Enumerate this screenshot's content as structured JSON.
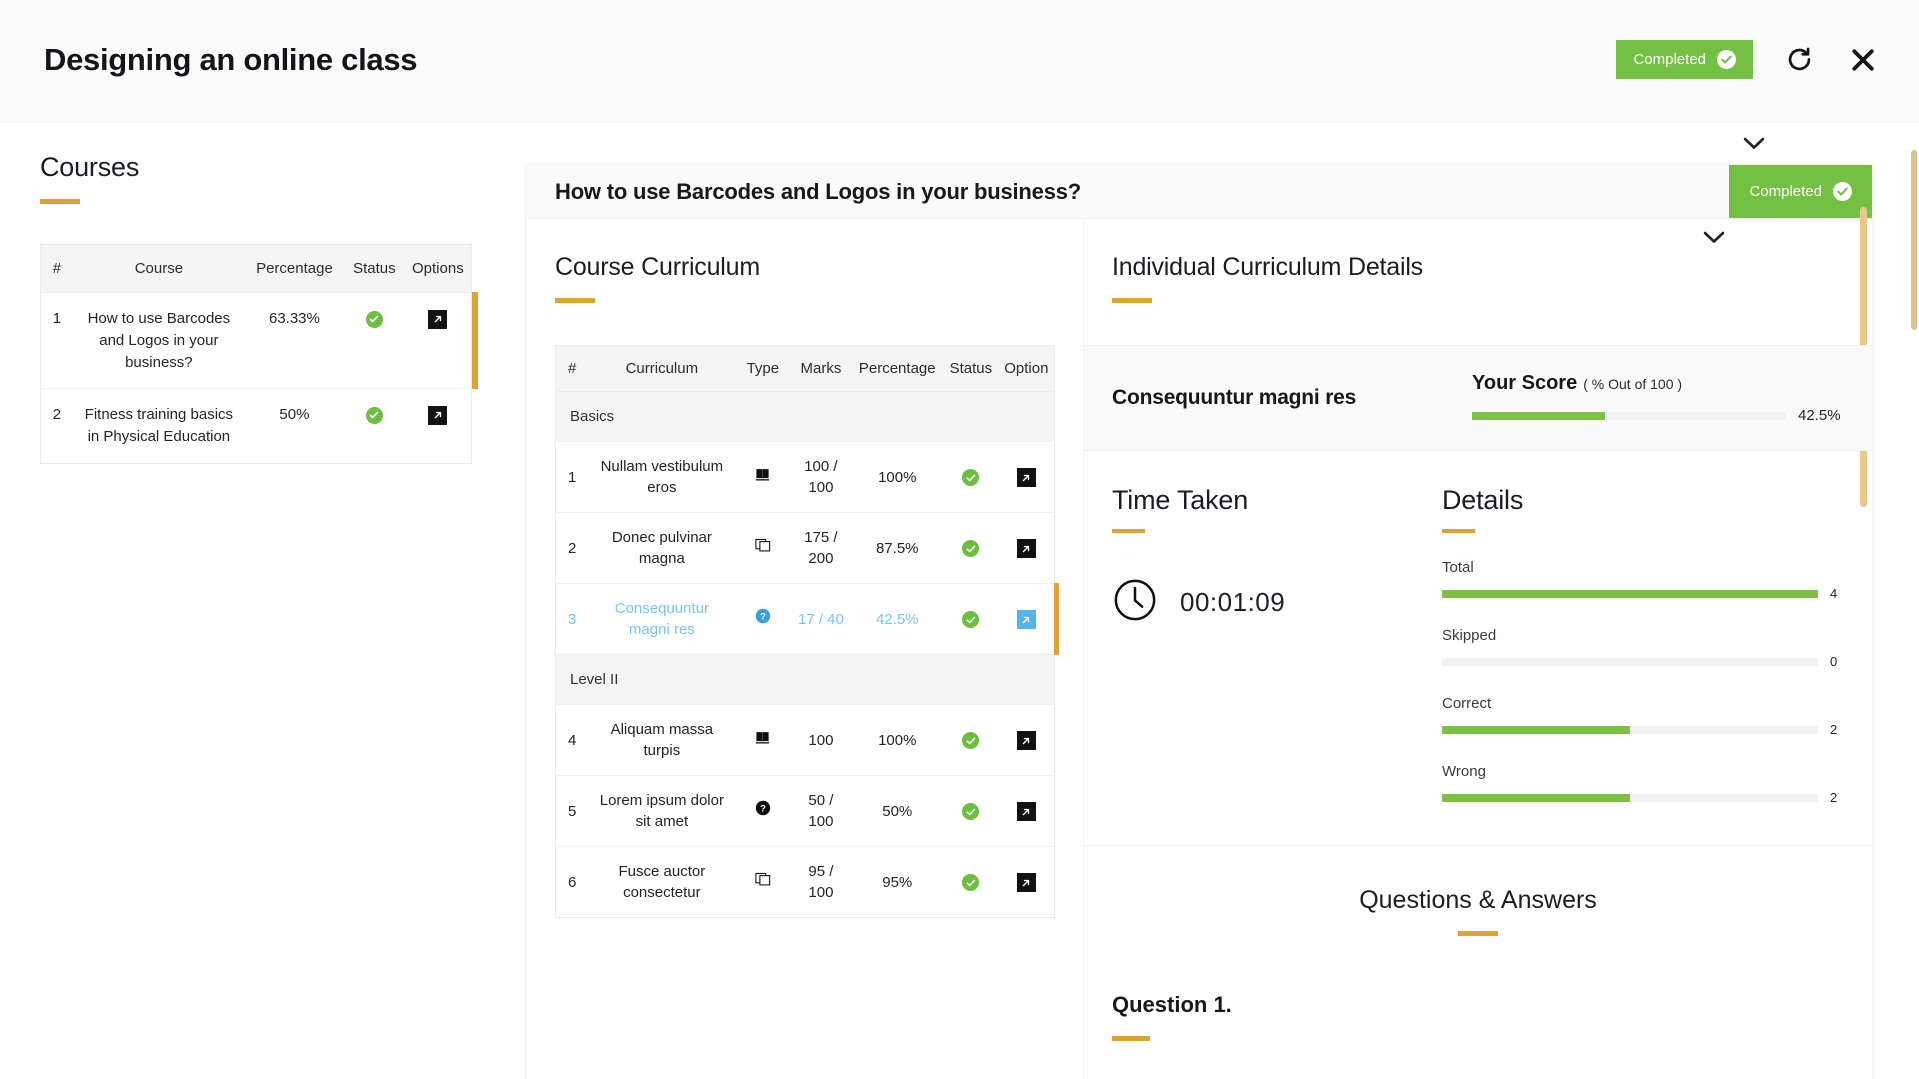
{
  "topbar": {
    "title": "Designing an online class",
    "status_badge": "Completed",
    "refresh_icon": "refresh-icon",
    "close_icon": "close-icon"
  },
  "sidebar": {
    "title": "Courses",
    "table": {
      "headers": [
        "#",
        "Course",
        "Percentage",
        "Status",
        "Options"
      ],
      "rows": [
        {
          "idx": "1",
          "course": "How to use Barcodes and Logos in your business?",
          "percentage": "63.33%",
          "status": "complete",
          "option": "open-icon",
          "selected": true
        },
        {
          "idx": "2",
          "course": "Fitness training basics in Physical Education",
          "percentage": "50%",
          "status": "complete",
          "option": "open-icon",
          "selected": false
        }
      ]
    }
  },
  "main": {
    "header_title": "How to use Barcodes and Logos in your business?",
    "header_badge": "Completed",
    "curriculum": {
      "title": "Course Curriculum",
      "headers": [
        "#",
        "Curriculum",
        "Type",
        "Marks",
        "Percentage",
        "Status",
        "Option"
      ],
      "rows": [
        {
          "kind": "group",
          "label": "Basics"
        },
        {
          "kind": "item",
          "idx": "1",
          "name": "Nullam vestibulum eros",
          "type": "book-icon",
          "marks": "100 / 100",
          "percentage": "100%",
          "status": "complete",
          "option": "open-icon",
          "selected": false
        },
        {
          "kind": "item",
          "idx": "2",
          "name": "Donec pulvinar magna",
          "type": "flashcard-icon",
          "marks": "175 / 200",
          "percentage": "87.5%",
          "status": "complete",
          "option": "open-icon",
          "selected": false
        },
        {
          "kind": "item",
          "idx": "3",
          "name": "Consequuntur magni res",
          "type": "question-icon",
          "marks": "17 / 40",
          "percentage": "42.5%",
          "status": "complete",
          "option": "open-icon",
          "selected": true
        },
        {
          "kind": "group",
          "label": "Level II"
        },
        {
          "kind": "item",
          "idx": "4",
          "name": "Aliquam massa turpis",
          "type": "book-icon",
          "marks": "100",
          "percentage": "100%",
          "status": "complete",
          "option": "open-icon",
          "selected": false
        },
        {
          "kind": "item",
          "idx": "5",
          "name": "Lorem ipsum dolor sit amet",
          "type": "question-icon",
          "marks": "50 / 100",
          "percentage": "50%",
          "status": "complete",
          "option": "open-icon",
          "selected": false
        },
        {
          "kind": "item",
          "idx": "6",
          "name": "Fusce auctor consectetur",
          "type": "flashcard-icon",
          "marks": "95 / 100",
          "percentage": "95%",
          "status": "complete",
          "option": "open-icon",
          "selected": false
        }
      ]
    },
    "details": {
      "title": "Individual Curriculum Details",
      "item_name": "Consequuntur magni res",
      "score_label": "Your Score",
      "score_sublabel": "( % Out of 100 )",
      "score_percent_text": "42.5%",
      "score_percent_value": 42.5,
      "time_taken_title": "Time Taken",
      "time_taken_value": "00:01:09",
      "details_title": "Details",
      "stats": [
        {
          "label": "Total",
          "value": "4",
          "fill": 100
        },
        {
          "label": "Skipped",
          "value": "0",
          "fill": 0
        },
        {
          "label": "Correct",
          "value": "2",
          "fill": 50
        },
        {
          "label": "Wrong",
          "value": "2",
          "fill": 50
        }
      ],
      "qa_title": "Questions & Answers",
      "question_heading": "Question 1."
    }
  },
  "colors": {
    "accent_gold": "#dfa234",
    "success_green": "#74c044",
    "bar_green": "#7cc143",
    "selected_blue": "#78c6ee"
  }
}
